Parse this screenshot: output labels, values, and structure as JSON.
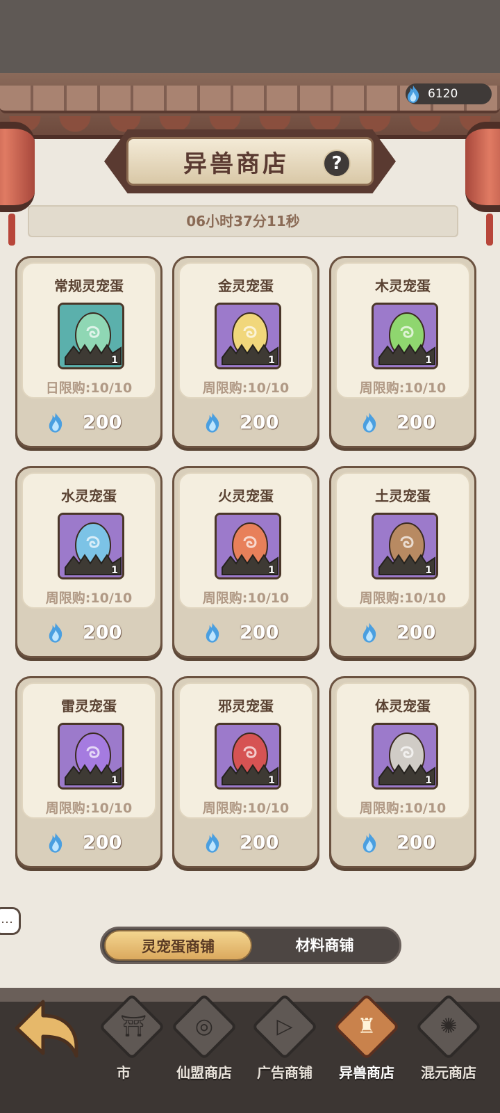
{
  "header": {
    "currency_value": "6120",
    "title": "异兽商店",
    "help_label": "?",
    "timer": "06小时37分11秒"
  },
  "items": [
    {
      "name": "常规灵宠蛋",
      "limit": "日限购:10/10",
      "price": "200",
      "qty": "1",
      "egg_color": "#8fd7b4",
      "bg_color": "#5bb0ac",
      "icon": "egg-icon"
    },
    {
      "name": "金灵宠蛋",
      "limit": "周限购:10/10",
      "price": "200",
      "qty": "1",
      "egg_color": "#f1d77b",
      "bg_color": "#9c7acb",
      "icon": "egg-icon"
    },
    {
      "name": "木灵宠蛋",
      "limit": "周限购:10/10",
      "price": "200",
      "qty": "1",
      "egg_color": "#8fd66f",
      "bg_color": "#9c7acb",
      "icon": "egg-icon"
    },
    {
      "name": "水灵宠蛋",
      "limit": "周限购:10/10",
      "price": "200",
      "qty": "1",
      "egg_color": "#7cc3e6",
      "bg_color": "#9c7acb",
      "icon": "egg-icon"
    },
    {
      "name": "火灵宠蛋",
      "limit": "周限购:10/10",
      "price": "200",
      "qty": "1",
      "egg_color": "#e8805a",
      "bg_color": "#9c7acb",
      "icon": "egg-icon"
    },
    {
      "name": "土灵宠蛋",
      "limit": "周限购:10/10",
      "price": "200",
      "qty": "1",
      "egg_color": "#b88a62",
      "bg_color": "#9c7acb",
      "icon": "egg-icon"
    },
    {
      "name": "雷灵宠蛋",
      "limit": "周限购:10/10",
      "price": "200",
      "qty": "1",
      "egg_color": "#a57be0",
      "bg_color": "#9c7acb",
      "icon": "egg-icon"
    },
    {
      "name": "邪灵宠蛋",
      "limit": "周限购:10/10",
      "price": "200",
      "qty": "1",
      "egg_color": "#d65353",
      "bg_color": "#9c7acb",
      "icon": "egg-icon"
    },
    {
      "name": "体灵宠蛋",
      "limit": "周限购:10/10",
      "price": "200",
      "qty": "1",
      "egg_color": "#d0ccc6",
      "bg_color": "#9c7acb",
      "icon": "egg-icon"
    }
  ],
  "tabs": {
    "active": "灵宠蛋商铺",
    "other": "材料商铺"
  },
  "nav": {
    "items": [
      {
        "label": "市",
        "glyph": "⛩"
      },
      {
        "label": "仙盟商店",
        "glyph": "◎"
      },
      {
        "label": "广告商铺",
        "glyph": "▷"
      },
      {
        "label": "异兽商店",
        "glyph": "♜"
      },
      {
        "label": "混元商店",
        "glyph": "✺"
      }
    ]
  },
  "chat_label": "…"
}
